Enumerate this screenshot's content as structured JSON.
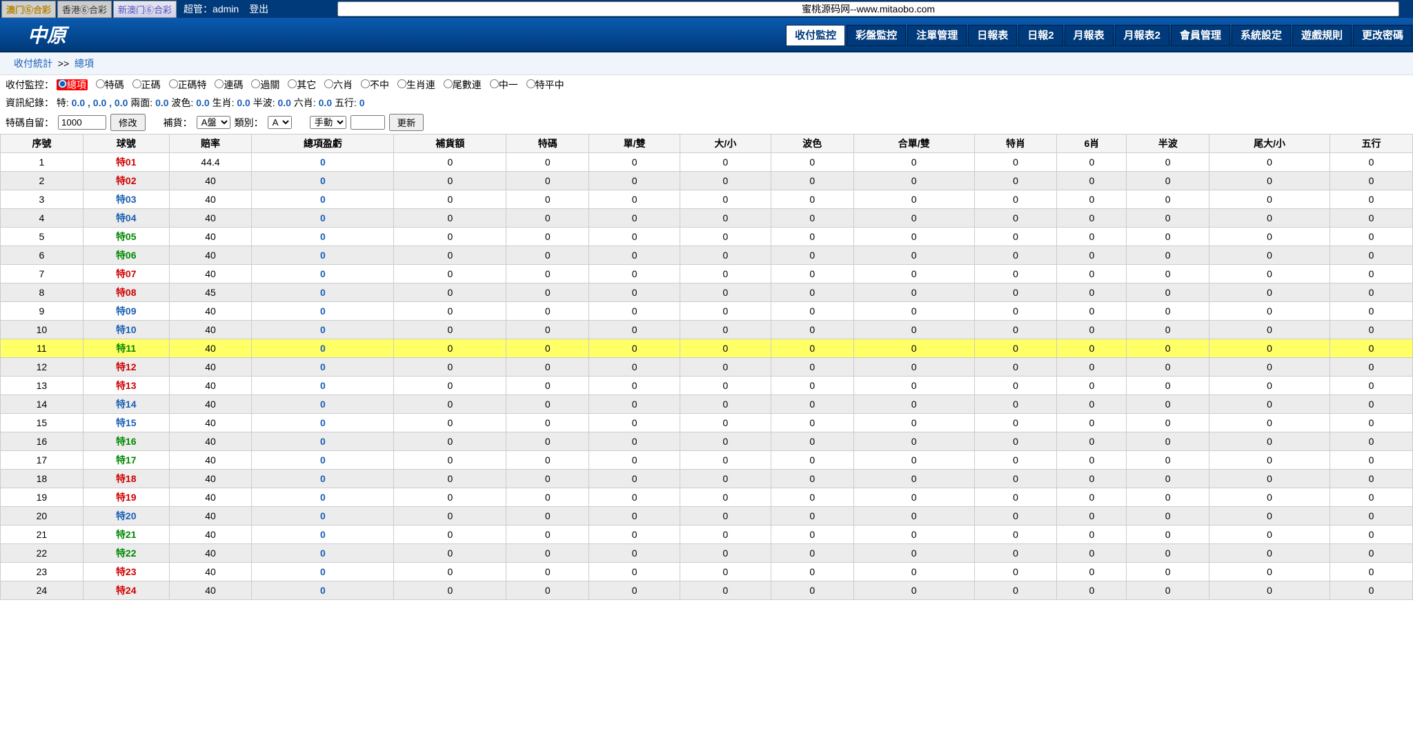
{
  "top": {
    "btn1": "澳门⑥合彩",
    "btn2": "香港⑥合彩",
    "btn3": "新澳门⑥合彩",
    "admin_label": "超管：admin",
    "logout": "登出",
    "search_text": "蜜桃源码网--www.mitaobo.com"
  },
  "nav": {
    "logo": "中原",
    "tabs": [
      "收付監控",
      "彩盤監控",
      "注單管理",
      "日報表",
      "日報2",
      "月報表",
      "月報表2",
      "會員管理",
      "系統設定",
      "遊戲規則",
      "更改密碼"
    ],
    "active_tab": "收付監控"
  },
  "breadcrumb": {
    "a": "收付統計",
    "sep": ">>",
    "b": "總項"
  },
  "filters": {
    "label": "收付監控：",
    "options": [
      "總項",
      "特碼",
      "正碼",
      "正碼特",
      "連碼",
      "過關",
      "其它",
      "六肖",
      "不中",
      "生肖連",
      "尾數連",
      "中一",
      "特平中"
    ],
    "selected": "總項"
  },
  "info": {
    "prefix": "資訊紀錄：",
    "items": [
      {
        "name": "特:",
        "value": "0.0 , 0.0 , 0.0"
      },
      {
        "name": "兩面:",
        "value": "0.0"
      },
      {
        "name": "波色:",
        "value": "0.0"
      },
      {
        "name": "生肖:",
        "value": "0.0"
      },
      {
        "name": "半波:",
        "value": "0.0"
      },
      {
        "name": "六肖:",
        "value": "0.0"
      },
      {
        "name": "五行:",
        "value": "0"
      }
    ]
  },
  "controls": {
    "label1": "特碼自留：",
    "input1": "1000",
    "modify": "修改",
    "label2": "補貨：",
    "sel_pan_options": [
      "A盤"
    ],
    "label3": "類別：",
    "sel_type_options": [
      "A"
    ],
    "sel_mode_options": [
      "手動"
    ],
    "input2": "",
    "update": "更新"
  },
  "table": {
    "headers": [
      "序號",
      "球號",
      "賠率",
      "總項盈虧",
      "補貨額",
      "特碼",
      "單/雙",
      "大/小",
      "波色",
      "合單/雙",
      "特肖",
      "6肖",
      "半波",
      "尾大/小",
      "五行"
    ],
    "rows": [
      {
        "seq": "1",
        "ball": "特01",
        "ballColor": "red",
        "rate": "44.4",
        "total": "0",
        "vals": [
          "0",
          "0",
          "0",
          "0",
          "0",
          "0",
          "0",
          "0",
          "0",
          "0",
          "0"
        ]
      },
      {
        "seq": "2",
        "ball": "特02",
        "ballColor": "red",
        "rate": "40",
        "total": "0",
        "vals": [
          "0",
          "0",
          "0",
          "0",
          "0",
          "0",
          "0",
          "0",
          "0",
          "0",
          "0"
        ]
      },
      {
        "seq": "3",
        "ball": "特03",
        "ballColor": "blue",
        "rate": "40",
        "total": "0",
        "vals": [
          "0",
          "0",
          "0",
          "0",
          "0",
          "0",
          "0",
          "0",
          "0",
          "0",
          "0"
        ]
      },
      {
        "seq": "4",
        "ball": "特04",
        "ballColor": "blue",
        "rate": "40",
        "total": "0",
        "vals": [
          "0",
          "0",
          "0",
          "0",
          "0",
          "0",
          "0",
          "0",
          "0",
          "0",
          "0"
        ]
      },
      {
        "seq": "5",
        "ball": "特05",
        "ballColor": "green",
        "rate": "40",
        "total": "0",
        "vals": [
          "0",
          "0",
          "0",
          "0",
          "0",
          "0",
          "0",
          "0",
          "0",
          "0",
          "0"
        ]
      },
      {
        "seq": "6",
        "ball": "特06",
        "ballColor": "green",
        "rate": "40",
        "total": "0",
        "vals": [
          "0",
          "0",
          "0",
          "0",
          "0",
          "0",
          "0",
          "0",
          "0",
          "0",
          "0"
        ]
      },
      {
        "seq": "7",
        "ball": "特07",
        "ballColor": "red",
        "rate": "40",
        "total": "0",
        "vals": [
          "0",
          "0",
          "0",
          "0",
          "0",
          "0",
          "0",
          "0",
          "0",
          "0",
          "0"
        ]
      },
      {
        "seq": "8",
        "ball": "特08",
        "ballColor": "red",
        "rate": "45",
        "total": "0",
        "vals": [
          "0",
          "0",
          "0",
          "0",
          "0",
          "0",
          "0",
          "0",
          "0",
          "0",
          "0"
        ]
      },
      {
        "seq": "9",
        "ball": "特09",
        "ballColor": "blue",
        "rate": "40",
        "total": "0",
        "vals": [
          "0",
          "0",
          "0",
          "0",
          "0",
          "0",
          "0",
          "0",
          "0",
          "0",
          "0"
        ]
      },
      {
        "seq": "10",
        "ball": "特10",
        "ballColor": "blue",
        "rate": "40",
        "total": "0",
        "vals": [
          "0",
          "0",
          "0",
          "0",
          "0",
          "0",
          "0",
          "0",
          "0",
          "0",
          "0"
        ]
      },
      {
        "seq": "11",
        "ball": "特11",
        "ballColor": "green",
        "rate": "40",
        "total": "0",
        "vals": [
          "0",
          "0",
          "0",
          "0",
          "0",
          "0",
          "0",
          "0",
          "0",
          "0",
          "0"
        ],
        "highlight": true
      },
      {
        "seq": "12",
        "ball": "特12",
        "ballColor": "red",
        "rate": "40",
        "total": "0",
        "vals": [
          "0",
          "0",
          "0",
          "0",
          "0",
          "0",
          "0",
          "0",
          "0",
          "0",
          "0"
        ]
      },
      {
        "seq": "13",
        "ball": "特13",
        "ballColor": "red",
        "rate": "40",
        "total": "0",
        "vals": [
          "0",
          "0",
          "0",
          "0",
          "0",
          "0",
          "0",
          "0",
          "0",
          "0",
          "0"
        ]
      },
      {
        "seq": "14",
        "ball": "特14",
        "ballColor": "blue",
        "rate": "40",
        "total": "0",
        "vals": [
          "0",
          "0",
          "0",
          "0",
          "0",
          "0",
          "0",
          "0",
          "0",
          "0",
          "0"
        ]
      },
      {
        "seq": "15",
        "ball": "特15",
        "ballColor": "blue",
        "rate": "40",
        "total": "0",
        "vals": [
          "0",
          "0",
          "0",
          "0",
          "0",
          "0",
          "0",
          "0",
          "0",
          "0",
          "0"
        ]
      },
      {
        "seq": "16",
        "ball": "特16",
        "ballColor": "green",
        "rate": "40",
        "total": "0",
        "vals": [
          "0",
          "0",
          "0",
          "0",
          "0",
          "0",
          "0",
          "0",
          "0",
          "0",
          "0"
        ]
      },
      {
        "seq": "17",
        "ball": "特17",
        "ballColor": "green",
        "rate": "40",
        "total": "0",
        "vals": [
          "0",
          "0",
          "0",
          "0",
          "0",
          "0",
          "0",
          "0",
          "0",
          "0",
          "0"
        ]
      },
      {
        "seq": "18",
        "ball": "特18",
        "ballColor": "red",
        "rate": "40",
        "total": "0",
        "vals": [
          "0",
          "0",
          "0",
          "0",
          "0",
          "0",
          "0",
          "0",
          "0",
          "0",
          "0"
        ]
      },
      {
        "seq": "19",
        "ball": "特19",
        "ballColor": "red",
        "rate": "40",
        "total": "0",
        "vals": [
          "0",
          "0",
          "0",
          "0",
          "0",
          "0",
          "0",
          "0",
          "0",
          "0",
          "0"
        ]
      },
      {
        "seq": "20",
        "ball": "特20",
        "ballColor": "blue",
        "rate": "40",
        "total": "0",
        "vals": [
          "0",
          "0",
          "0",
          "0",
          "0",
          "0",
          "0",
          "0",
          "0",
          "0",
          "0"
        ]
      },
      {
        "seq": "21",
        "ball": "特21",
        "ballColor": "green",
        "rate": "40",
        "total": "0",
        "vals": [
          "0",
          "0",
          "0",
          "0",
          "0",
          "0",
          "0",
          "0",
          "0",
          "0",
          "0"
        ]
      },
      {
        "seq": "22",
        "ball": "特22",
        "ballColor": "green",
        "rate": "40",
        "total": "0",
        "vals": [
          "0",
          "0",
          "0",
          "0",
          "0",
          "0",
          "0",
          "0",
          "0",
          "0",
          "0"
        ]
      },
      {
        "seq": "23",
        "ball": "特23",
        "ballColor": "red",
        "rate": "40",
        "total": "0",
        "vals": [
          "0",
          "0",
          "0",
          "0",
          "0",
          "0",
          "0",
          "0",
          "0",
          "0",
          "0"
        ]
      },
      {
        "seq": "24",
        "ball": "特24",
        "ballColor": "red",
        "rate": "40",
        "total": "0",
        "vals": [
          "0",
          "0",
          "0",
          "0",
          "0",
          "0",
          "0",
          "0",
          "0",
          "0",
          "0"
        ]
      }
    ]
  }
}
